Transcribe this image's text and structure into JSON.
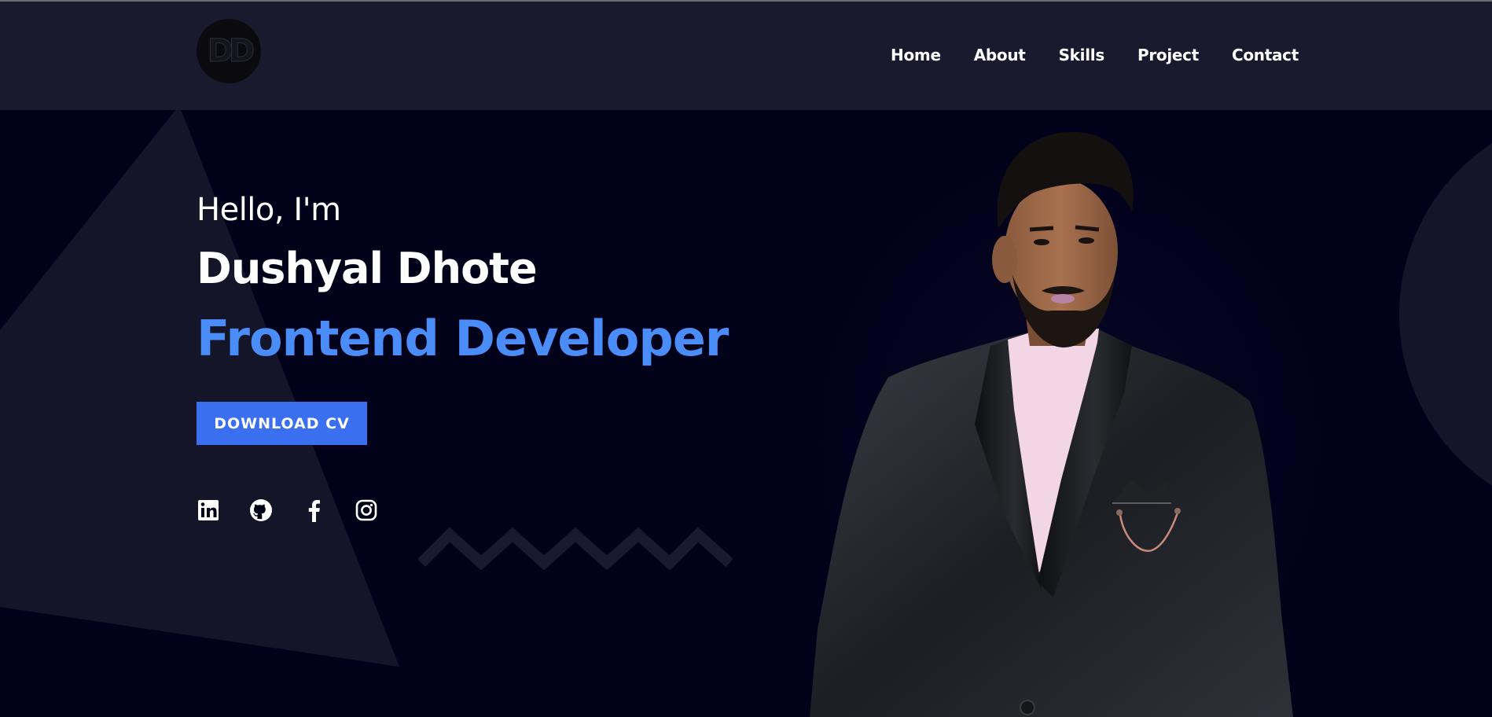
{
  "logo": {
    "text": "DD"
  },
  "nav": {
    "items": [
      {
        "label": "Home"
      },
      {
        "label": "About"
      },
      {
        "label": "Skills"
      },
      {
        "label": "Project"
      },
      {
        "label": "Contact"
      }
    ]
  },
  "hero": {
    "greeting": "Hello, I'm",
    "name": "Dushyal Dhote",
    "role": "Frontend Developer",
    "cv_button": "DOWNLOAD CV",
    "socials": [
      {
        "icon": "linkedin-icon"
      },
      {
        "icon": "github-icon"
      },
      {
        "icon": "facebook-icon"
      },
      {
        "icon": "instagram-icon"
      }
    ]
  },
  "colors": {
    "navbar_bg": "#1a1a2e",
    "hero_bg": "#02011a",
    "accent_text": "#4a8df8",
    "button_bg": "#3a6ff0",
    "shape": "#15152a"
  }
}
